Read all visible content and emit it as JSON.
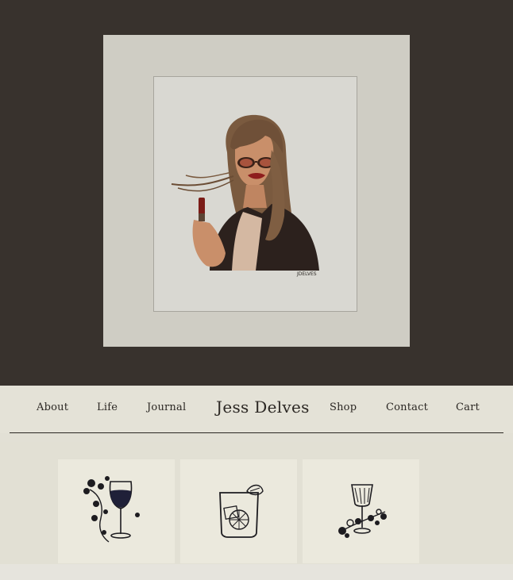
{
  "hero": {
    "artwork": "portrait-illustration",
    "signature": "JDELVES"
  },
  "nav": {
    "about": "About",
    "life": "Life",
    "journal": "Journal",
    "brand": "Jess Delves",
    "shop": "Shop",
    "contact": "Contact",
    "cart": "Cart"
  },
  "tiles": [
    {
      "icon": "wine-glass-floral-icon"
    },
    {
      "icon": "whiskey-glass-orange-icon"
    },
    {
      "icon": "coupe-glass-floral-icon"
    }
  ],
  "colors": {
    "hero_bg": "#38322d",
    "mat": "#cfcdc4",
    "nav_bg": "#e4e2d7",
    "text": "#2b2723"
  }
}
